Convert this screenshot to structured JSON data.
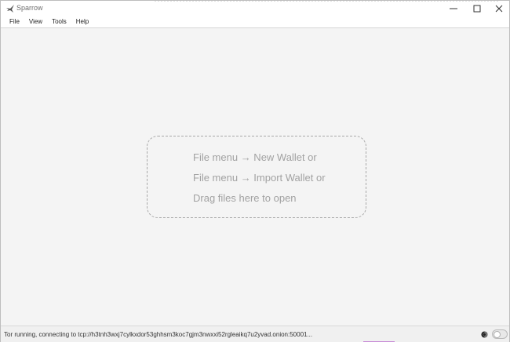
{
  "window": {
    "title": "Sparrow",
    "icon": "sparrow-logo-icon"
  },
  "window_controls": {
    "minimize_icon": "minimize-icon",
    "maximize_icon": "maximize-icon",
    "close_icon": "close-icon"
  },
  "menubar": {
    "items": [
      {
        "label": "File"
      },
      {
        "label": "View"
      },
      {
        "label": "Tools"
      },
      {
        "label": "Help"
      }
    ]
  },
  "dropzone": {
    "lines": [
      "File menu → New Wallet or",
      "File menu → Import Wallet or",
      "Drag files here to open"
    ]
  },
  "statusbar": {
    "text": "Tor running, connecting to tcp://h3tnh3wxj7cylkxdor53ghhsm3koc7gjm3nwxxi52rgleaikq7u2yvad.onion:50001...",
    "tor_icon": "tor-onion-icon",
    "toggle_on": false
  },
  "colors": {
    "background": "#f4f4f4",
    "hint_text": "#a2a2a2",
    "dash_border": "#a8a8a8"
  }
}
